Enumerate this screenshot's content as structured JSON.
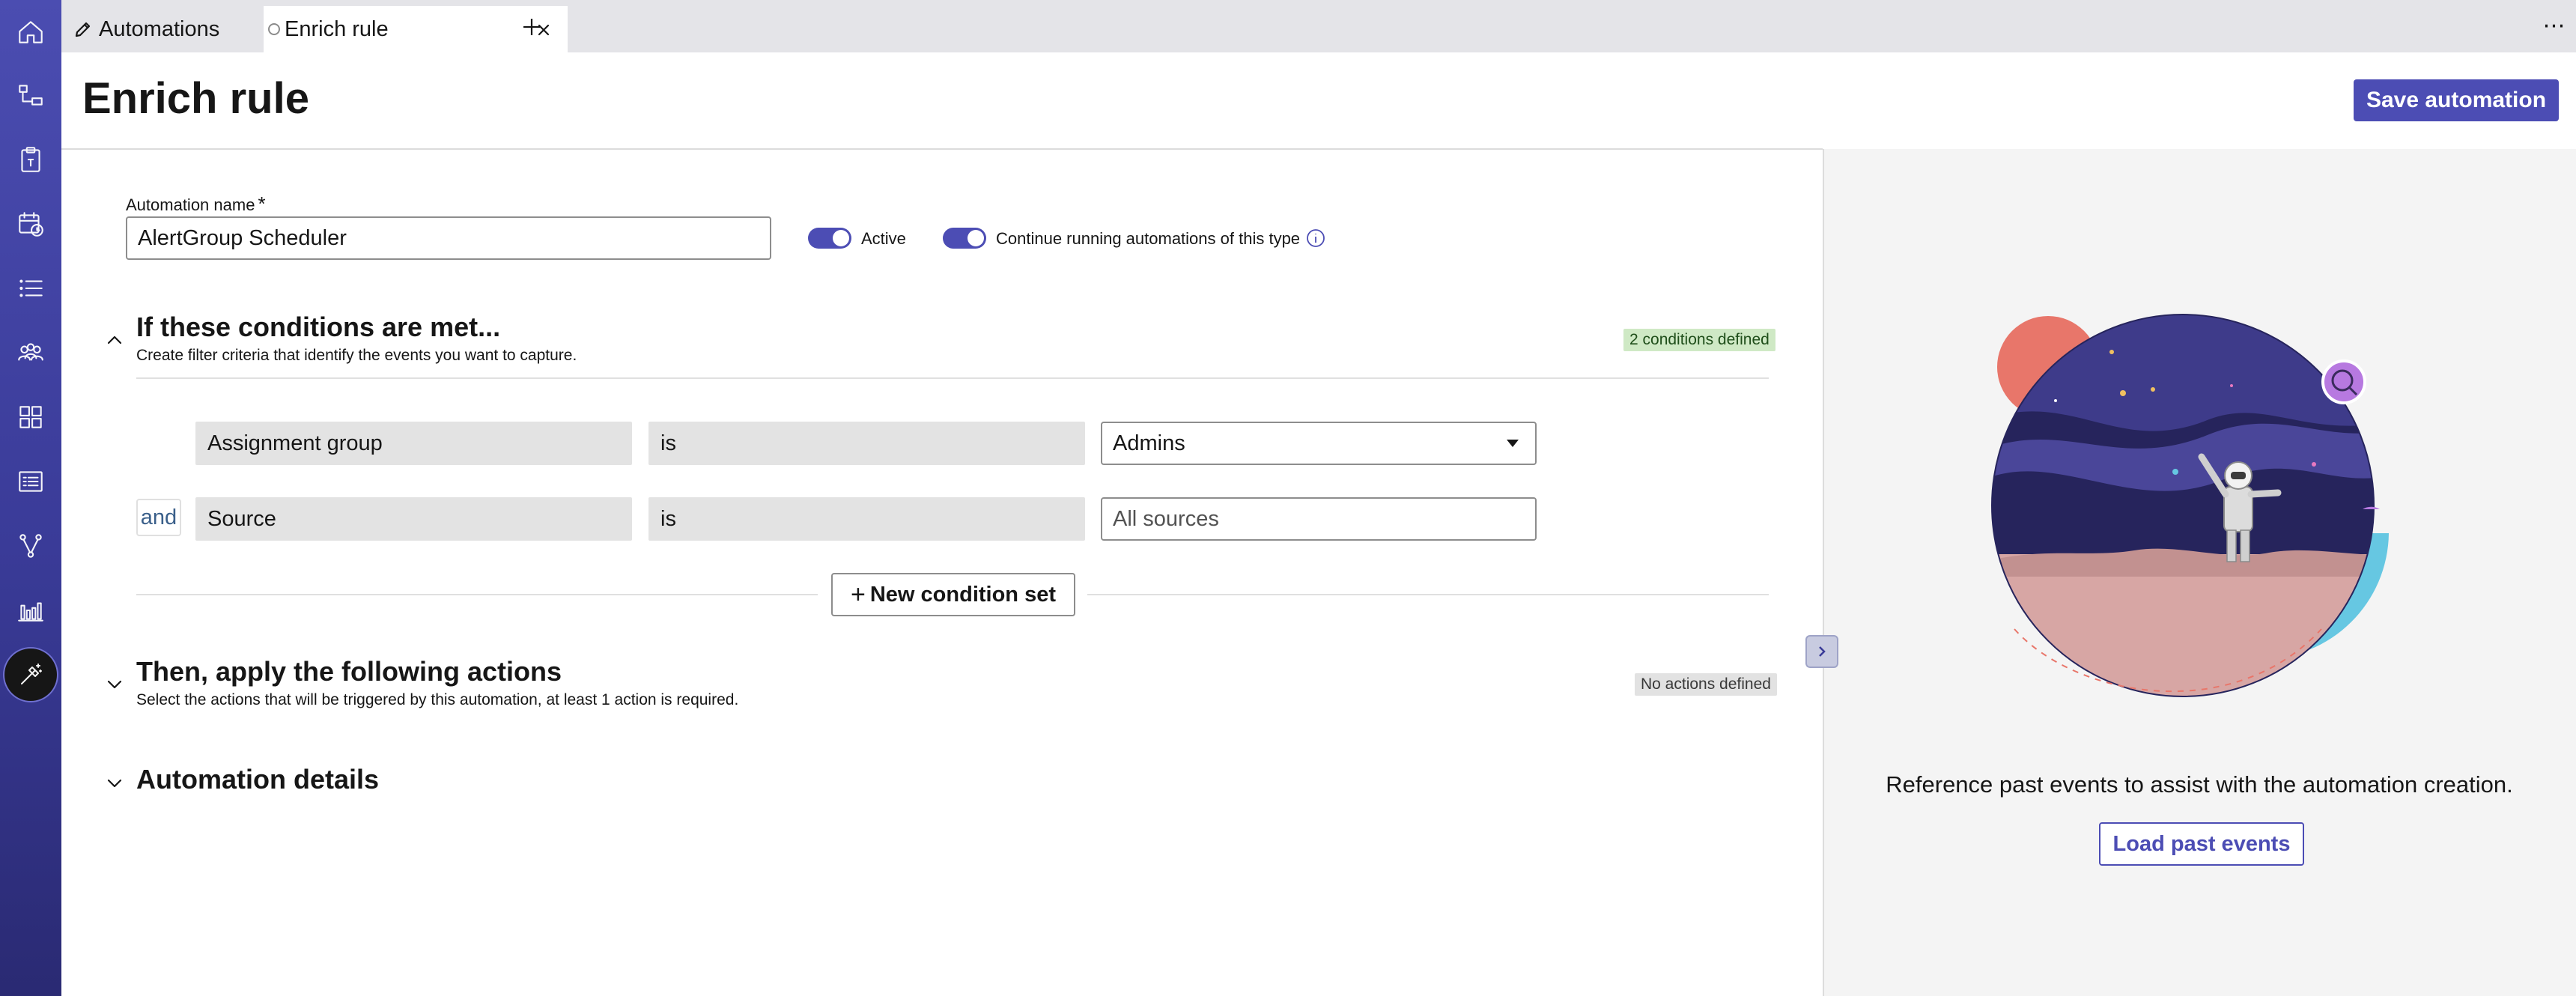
{
  "tabs": [
    {
      "label": "Automations",
      "icon": "pencil-icon"
    },
    {
      "label": "Enrich rule",
      "icon": "loading-icon"
    }
  ],
  "nav_icons": [
    "home-icon",
    "flow-icon",
    "clipboard-icon",
    "calendar-clock-icon",
    "list-icon",
    "team-icon",
    "grid-icon",
    "table-list-icon",
    "branch-icon",
    "bar-chart-icon",
    "magic-wand-icon"
  ],
  "header": {
    "title": "Enrich rule",
    "save_label": "Save automation"
  },
  "form": {
    "name_label": "Automation name",
    "required_mark": "*",
    "name_value": "AlertGroup Scheduler",
    "toggle_active_label": "Active",
    "toggle_continue_label": "Continue running automations of this type"
  },
  "conditions": {
    "title": "If these conditions are met...",
    "description": "Create filter criteria that identify the events you want to capture.",
    "badge": "2 conditions defined",
    "rows": [
      {
        "field": "Assignment group",
        "operator": "is",
        "value": "Admins"
      },
      {
        "connector": "and",
        "field": "Source",
        "operator": "is",
        "value": "All sources"
      }
    ],
    "new_condition_label": "New condition set"
  },
  "actions": {
    "title": "Then, apply the following actions",
    "description": "Select the actions that will be triggered by this automation, at least 1 action is required.",
    "badge": "No actions defined"
  },
  "details": {
    "title": "Automation details"
  },
  "side_panel": {
    "text": "Reference past events to assist with the automation creation.",
    "load_label": "Load past events"
  },
  "colors": {
    "accent": "#4c4db4",
    "rail_top": "#4b4db1",
    "rail_bottom": "#2a2a73",
    "badge_green": "#cfe9c5"
  }
}
